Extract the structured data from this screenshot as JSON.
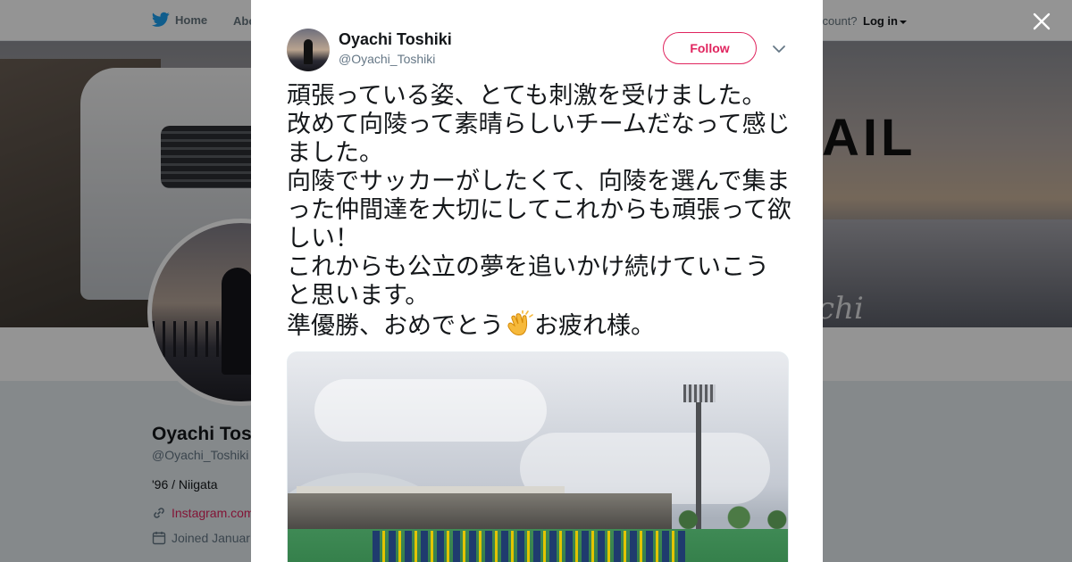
{
  "nav": {
    "home": "Home",
    "about": "Abo",
    "account_prompt": "ccount?",
    "login": "Log in"
  },
  "banner": {
    "text": "AIL",
    "signature": "chi"
  },
  "profile": {
    "name": "Oyachi Tos",
    "handle": "@Oyachi_Toshiki",
    "bio": "'96 / Niigata",
    "link": "Instagram.com",
    "joined": "Joined Januar"
  },
  "tweet": {
    "name": "Oyachi Toshiki",
    "handle": "@Oyachi_Toshiki",
    "follow_label": "Follow",
    "text": "頑張っている姿、とても刺激を受けました。\n改めて向陵って素晴らしいチームだなって感じました。\n向陵でサッカーがしたくて、向陵を選んで集まった仲間達を大切にしてこれからも頑張って欲しい！\nこれからも公立の夢を追いかけ続けていこうと思います。\n準優勝、おめでとう",
    "text_end": "お疲れ様。",
    "emoji": "clapping-hands"
  },
  "colors": {
    "accent": "#e0245e",
    "twitter_blue": "#1da1f2",
    "text": "#14171a",
    "muted": "#657786"
  }
}
